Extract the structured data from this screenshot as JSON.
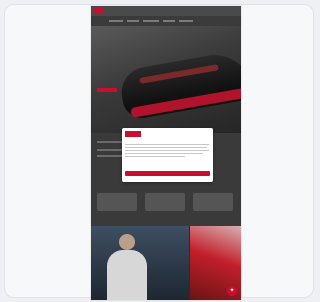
{
  "colors": {
    "background": "#eef0f4",
    "card": "#f7f8fa",
    "accent": "#c8102e",
    "dark": "#2b2b2b"
  },
  "app": {
    "brand_logo": "logo-mark",
    "hero": {
      "title": "",
      "subtitle": ""
    },
    "tiles": {
      "left_caption": "",
      "right_caption": ""
    },
    "fab_icon": "chat-icon"
  },
  "modal": {
    "brand": "",
    "heading": "",
    "links": "",
    "accept_label": ""
  }
}
